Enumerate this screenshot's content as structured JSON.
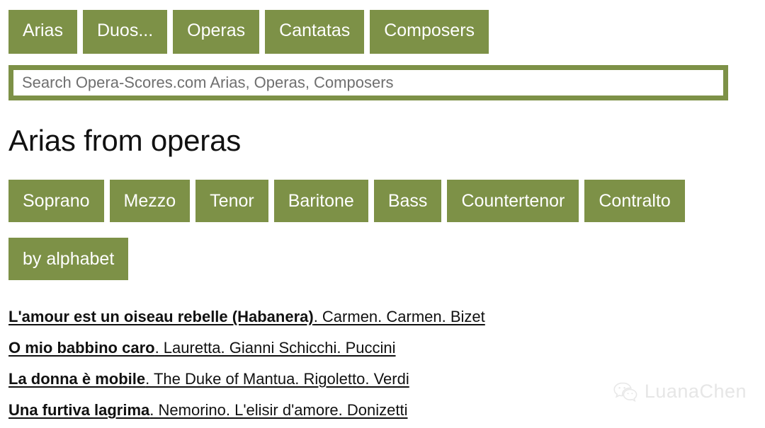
{
  "site": {
    "name": "Opera-Scores.com",
    "accent_color": "#7d9147",
    "background_color": "#ffffff",
    "text_color": "#111111"
  },
  "topnav": {
    "items": [
      {
        "label": "Arias"
      },
      {
        "label": "Duos..."
      },
      {
        "label": "Operas"
      },
      {
        "label": "Cantatas"
      },
      {
        "label": "Composers"
      }
    ]
  },
  "search": {
    "value": "",
    "placeholder": "Search Opera-Scores.com Arias, Operas, Composers"
  },
  "main": {
    "title": "Arias from operas",
    "voice_types": [
      {
        "label": "Soprano"
      },
      {
        "label": "Mezzo"
      },
      {
        "label": "Tenor"
      },
      {
        "label": "Baritone"
      },
      {
        "label": "Bass"
      },
      {
        "label": "Countertenor"
      },
      {
        "label": "Contralto"
      }
    ],
    "alphabet_buttons": [
      {
        "label": "by alphabet"
      }
    ],
    "arias": [
      {
        "title": "L'amour est un oiseau rebelle (Habanera)",
        "details": ". Carmen. Carmen. Bizet"
      },
      {
        "title": "O mio babbino caro",
        "details": ". Lauretta. Gianni Schicchi. Puccini"
      },
      {
        "title": "La donna è mobile",
        "details": ". The Duke of Mantua. Rigoletto. Verdi"
      },
      {
        "title": "Una furtiva lagrima",
        "details": ". Nemorino. L'elisir d'amore. Donizetti"
      }
    ]
  },
  "watermark": {
    "icon": "wechat-icon",
    "label": "LuanaChen",
    "color": "#d2d2d2"
  }
}
